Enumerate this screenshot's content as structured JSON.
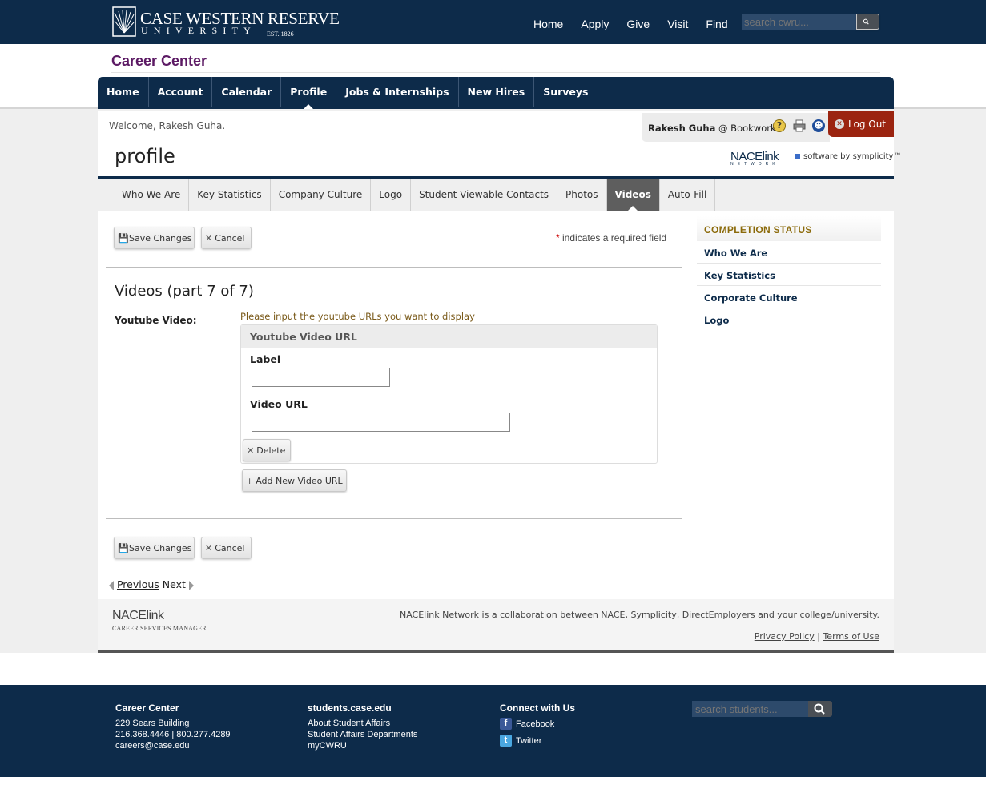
{
  "header": {
    "logo_line1": "CASE WESTERN RESERVE",
    "logo_line2": "UNIVERSITY",
    "logo_line3": "EST. 1826",
    "nav": [
      "Home",
      "Apply",
      "Give",
      "Visit",
      "Find"
    ],
    "search_placeholder": "search cwru..."
  },
  "site_title": "Career Center",
  "main_nav": {
    "items": [
      "Home",
      "Account",
      "Calendar",
      "Profile",
      "Jobs & Internships",
      "New Hires",
      "Surveys"
    ],
    "active": "Profile"
  },
  "user": {
    "welcome": "Welcome, Rakesh Guha.",
    "name": "Rakesh Guha",
    "org": "@ Bookwork",
    "logout_label": "Log Out"
  },
  "page_title": "profile",
  "branding": {
    "nace": "NACElink",
    "nace_sub": "NETWORK",
    "symplicity": "software by symplicity™"
  },
  "sub_nav": {
    "items": [
      "Who We Are",
      "Key Statistics",
      "Company Culture",
      "Logo",
      "Student Viewable Contacts",
      "Photos",
      "Videos",
      "Auto-Fill"
    ],
    "active": "Videos"
  },
  "form": {
    "save_label": "Save Changes",
    "cancel_label": "Cancel",
    "required_star": "*",
    "required_note": "indicates a required field",
    "section_title": "Videos (part 7 of 7)",
    "youtube_label": "Youtube Video:",
    "youtube_hint": "Please input the youtube URLs you want to display",
    "box_header": "Youtube Video URL",
    "label_field": "Label",
    "label_value": "",
    "url_field": "Video URL",
    "url_value": "",
    "delete_label": "Delete",
    "add_label": "Add New Video URL"
  },
  "pager": {
    "previous": "Previous",
    "next": "Next"
  },
  "completion": {
    "title": "COMPLETION STATUS",
    "items": [
      "Who We Are",
      "Key Statistics",
      "Corporate Culture",
      "Logo"
    ]
  },
  "panel_footer": {
    "logo": "NACElink",
    "logo_sub": "CAREER SERVICES MANAGER",
    "text": "NACElink Network is a collaboration between NACE, Symplicity, DirectEmployers and your college/university.",
    "privacy": "Privacy Policy",
    "separator": "|",
    "terms": "Terms of Use"
  },
  "footer": {
    "col1": {
      "title": "Career Center",
      "lines": [
        "229 Sears Building",
        "216.368.4446 | 800.277.4289",
        "careers@case.edu"
      ]
    },
    "col2": {
      "title": "students.case.edu",
      "lines": [
        "About Student Affairs",
        "Student Affairs Departments",
        "myCWRU"
      ]
    },
    "col3": {
      "title": "Connect with Us",
      "facebook": "Facebook",
      "twitter": "Twitter"
    },
    "search_placeholder": "search students..."
  },
  "colors": {
    "navy": "#0d2b4a",
    "purple_title": "#5c1a64",
    "logout_red": "#9b2410",
    "completion_gold": "#8b6a0a"
  }
}
